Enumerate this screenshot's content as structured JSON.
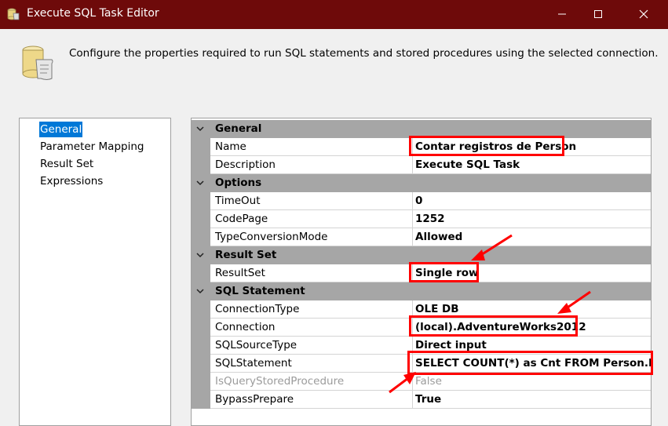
{
  "window": {
    "title": "Execute SQL Task Editor",
    "titlebar_color": "#6e0a0a",
    "controls": {
      "minimize": "minimize-icon",
      "maximize": "maximize-icon",
      "close": "close-icon"
    }
  },
  "header": {
    "description": "Configure the properties required to run SQL statements and stored procedures using the selected connection."
  },
  "nav": {
    "items": [
      {
        "label": "General",
        "selected": true
      },
      {
        "label": "Parameter Mapping",
        "selected": false
      },
      {
        "label": "Result Set",
        "selected": false
      },
      {
        "label": "Expressions",
        "selected": false
      }
    ],
    "selection_color": "#0078d7"
  },
  "grid": {
    "categories": [
      {
        "label": "General",
        "properties": [
          {
            "name": "Name",
            "value": "Contar registros de Person"
          },
          {
            "name": "Description",
            "value": "Execute SQL Task"
          }
        ]
      },
      {
        "label": "Options",
        "properties": [
          {
            "name": "TimeOut",
            "value": "0"
          },
          {
            "name": "CodePage",
            "value": "1252"
          },
          {
            "name": "TypeConversionMode",
            "value": "Allowed"
          }
        ]
      },
      {
        "label": "Result Set",
        "properties": [
          {
            "name": "ResultSet",
            "value": "Single row"
          }
        ]
      },
      {
        "label": "SQL Statement",
        "properties": [
          {
            "name": "ConnectionType",
            "value": "OLE DB"
          },
          {
            "name": "Connection",
            "value": "(local).AdventureWorks2012"
          },
          {
            "name": "SQLSourceType",
            "value": "Direct input"
          },
          {
            "name": "SQLStatement",
            "value": "SELECT COUNT(*) as Cnt FROM Person.Person"
          },
          {
            "name": "IsQueryStoredProcedure",
            "value": "False",
            "disabled": true
          },
          {
            "name": "BypassPrepare",
            "value": "True"
          }
        ]
      }
    ]
  },
  "annotations": {
    "highlight_color": "#ff0000",
    "highlighted_properties": [
      "Name",
      "ResultSet",
      "Connection",
      "SQLStatement"
    ]
  }
}
